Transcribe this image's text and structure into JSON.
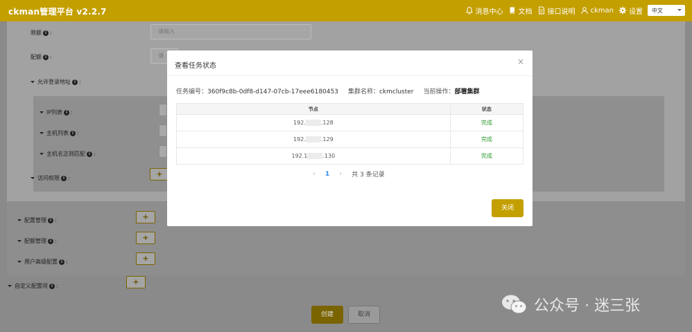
{
  "header": {
    "title": "ckman管理平台 v2.2.7",
    "nav": {
      "messages": "消息中心",
      "docs": "文档",
      "api": "接口说明",
      "user": "ckman",
      "settings": "设置"
    },
    "language": "中文"
  },
  "form": {
    "quota_label": "限额",
    "quota_placeholder": "请输入",
    "profile_label": "配额",
    "profile_placeholder": "请",
    "allow_login": "允许登录地址",
    "ip_list": "IP列表",
    "host_list": "主机列表",
    "host_regex": "主机名正则匹配",
    "access": "访问权限",
    "config_mgmt": "配置管理",
    "quota_mgmt": "配额管理",
    "user_advanced": "用户高级配置",
    "custom_config": "自定义配置项",
    "plus": "+",
    "create": "创建",
    "cancel": "取消"
  },
  "modal": {
    "title": "查看任务状态",
    "close_icon": "×",
    "task_id_label": "任务编号：",
    "task_id": "360f9c8b-0df8-d147-07cb-17eee6180453",
    "cluster_label": "集群名称：",
    "cluster": "ckmcluster",
    "op_label": "当前操作：",
    "op": "部署集群",
    "table": {
      "headers": [
        "节点",
        "状态"
      ],
      "rows": [
        {
          "ip_prefix": "192.",
          "ip_suffix": ".128",
          "status": "完成"
        },
        {
          "ip_prefix": "192.",
          "ip_suffix": ".129",
          "status": "完成"
        },
        {
          "ip_prefix": "192.1",
          "ip_suffix": ".130",
          "status": "完成"
        }
      ]
    },
    "pager": {
      "prev": "‹",
      "page": "1",
      "next": "›",
      "total": "共 3 条记录"
    },
    "ok_button": "关闭"
  },
  "watermark": "公众号 · 迷三张",
  "colors": {
    "brand": "#c49f00",
    "success": "#2e9b2e",
    "link": "#2d8cf0"
  }
}
